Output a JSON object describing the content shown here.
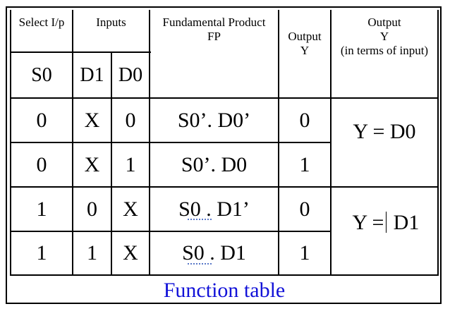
{
  "headers": {
    "select": "Select I/p",
    "inputs": "Inputs",
    "fp_line1": "Fundamental Product",
    "fp_line2": "FP",
    "output1_line1": "Output",
    "output1_line2": "Y",
    "output2_line1": "Output",
    "output2_line2": "Y",
    "output2_line3": "(in terms of input)"
  },
  "subheaders": {
    "s0": "S0",
    "d1": "D1",
    "d0": "D0"
  },
  "rows": [
    {
      "s0": "0",
      "d1": "X",
      "d0": "0",
      "fp": "S0’. D0’",
      "y": "0"
    },
    {
      "s0": "0",
      "d1": "X",
      "d0": "1",
      "fp": "S0’. D0",
      "y": "1"
    },
    {
      "s0": "1",
      "d1": "0",
      "d0": "X",
      "fp": "S0 . D1’",
      "y": "0"
    },
    {
      "s0": "1",
      "d1": "1",
      "d0": "X",
      "fp": "S0 . D1",
      "y": "1"
    }
  ],
  "groups": {
    "top": "Y = D0",
    "bottom_left": "Y =",
    "bottom_right": "D1"
  },
  "caption": "Function table",
  "colors": {
    "caption": "#1212d8",
    "grid": "#000000"
  }
}
